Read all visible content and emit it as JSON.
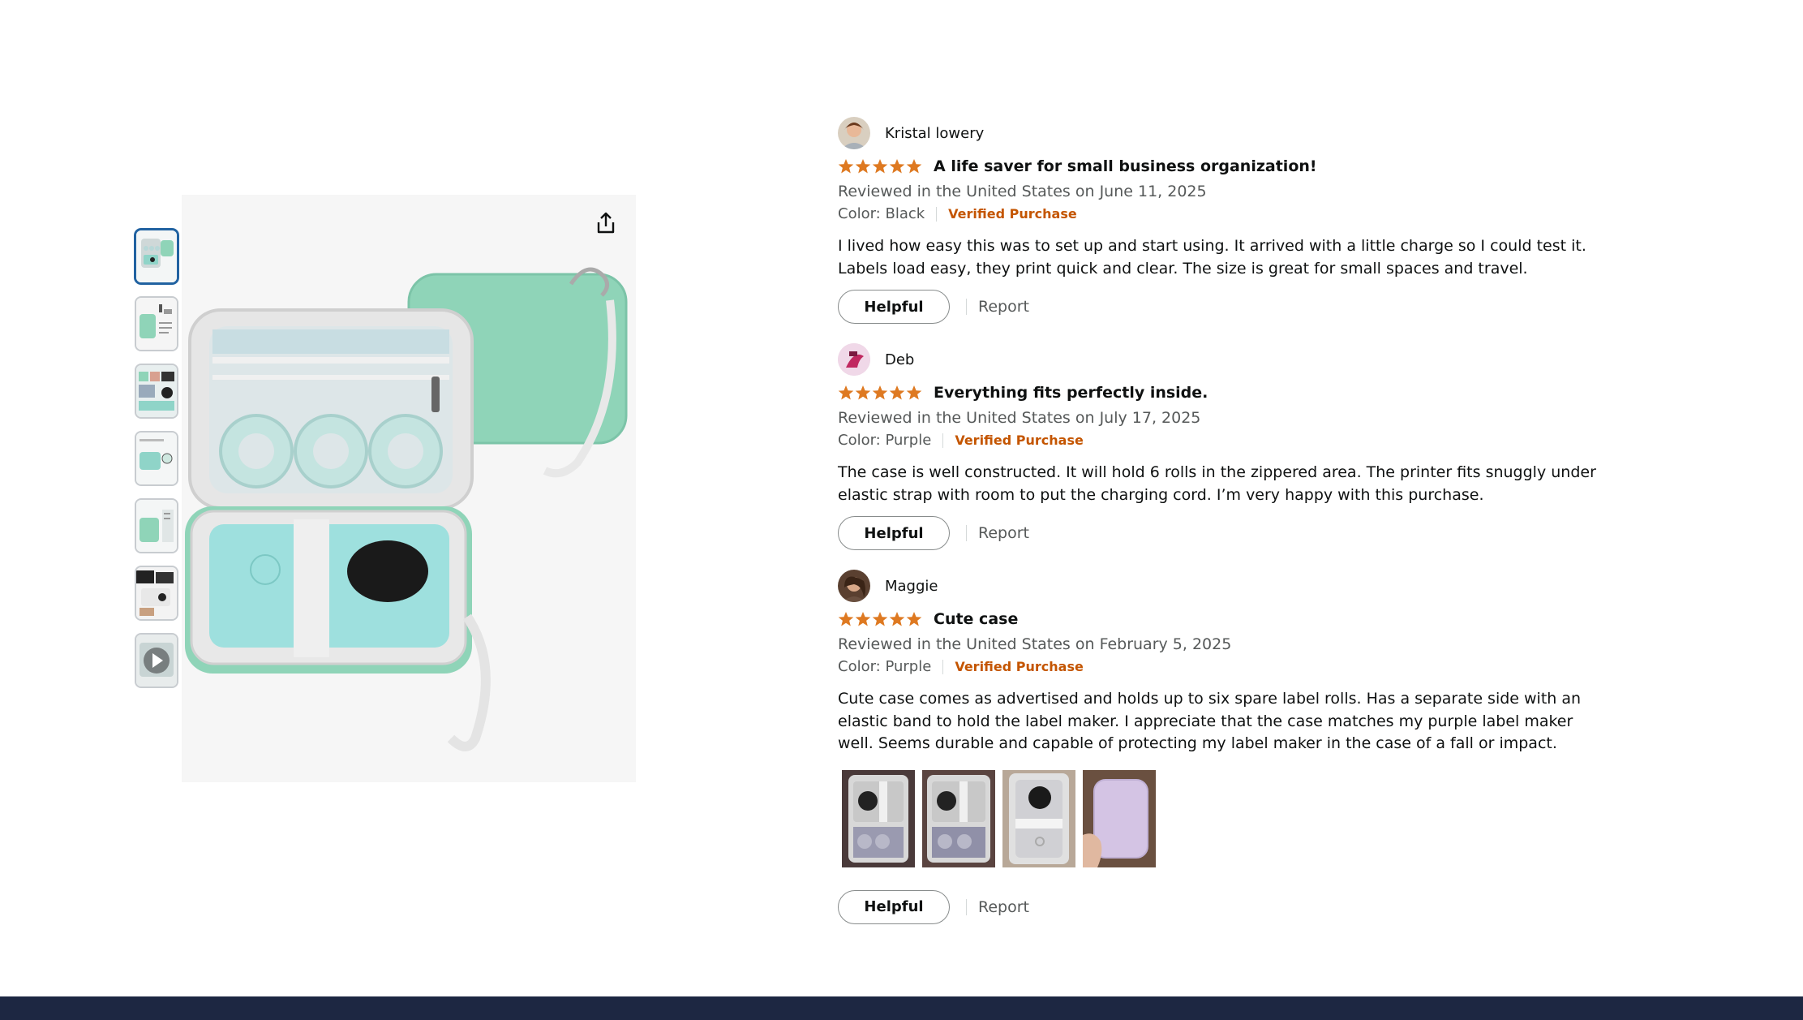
{
  "gallery": {
    "thumbnails": [
      {
        "kind": "image",
        "active": true
      },
      {
        "kind": "image",
        "active": false
      },
      {
        "kind": "image",
        "active": false
      },
      {
        "kind": "image",
        "active": false
      },
      {
        "kind": "image",
        "active": false
      },
      {
        "kind": "image",
        "active": false
      },
      {
        "kind": "video",
        "active": false
      }
    ],
    "share_icon": "share-icon",
    "product_color": "#8fd4b8"
  },
  "reviews": [
    {
      "name": "Kristal lowery",
      "rating": 5,
      "title": "A life saver for small business organization!",
      "reviewed": "Reviewed in the United States on June 11, 2025",
      "color": "Color: Black",
      "verified": "Verified Purchase",
      "body": "I lived how easy this was to set up and start using. It arrived with a little charge so I could test it. Labels load easy, they print quick and clear. The size is great for small spaces and travel.",
      "helpful": "Helpful",
      "report": "Report"
    },
    {
      "name": "Deb",
      "rating": 5,
      "title": "Everything fits perfectly inside.",
      "reviewed": "Reviewed in the United States on July 17, 2025",
      "color": "Color: Purple",
      "verified": "Verified Purchase",
      "body": "The case is well constructed. It will hold 6 rolls in the zippered area. The printer fits snuggly under elastic strap with room to put the charging cord. I’m very happy with this purchase.",
      "helpful": "Helpful",
      "report": "Report"
    },
    {
      "name": "Maggie",
      "rating": 5,
      "title": "Cute case",
      "reviewed": "Reviewed in the United States on February 5, 2025",
      "color": "Color: Purple",
      "verified": "Verified Purchase",
      "body": "Cute case comes as advertised and holds up to six spare label rolls. Has a separate side with an elastic band to hold the label maker. I appreciate that the case matches my purple label maker well. Seems durable and capable of protecting my label maker in the case of a fall or impact.",
      "helpful": "Helpful",
      "report": "Report",
      "photo_count": 4
    }
  ],
  "colors": {
    "star": "#de7921",
    "verified": "#c45500",
    "footer": "#1d2742",
    "active_thumb": "#2162a1"
  }
}
